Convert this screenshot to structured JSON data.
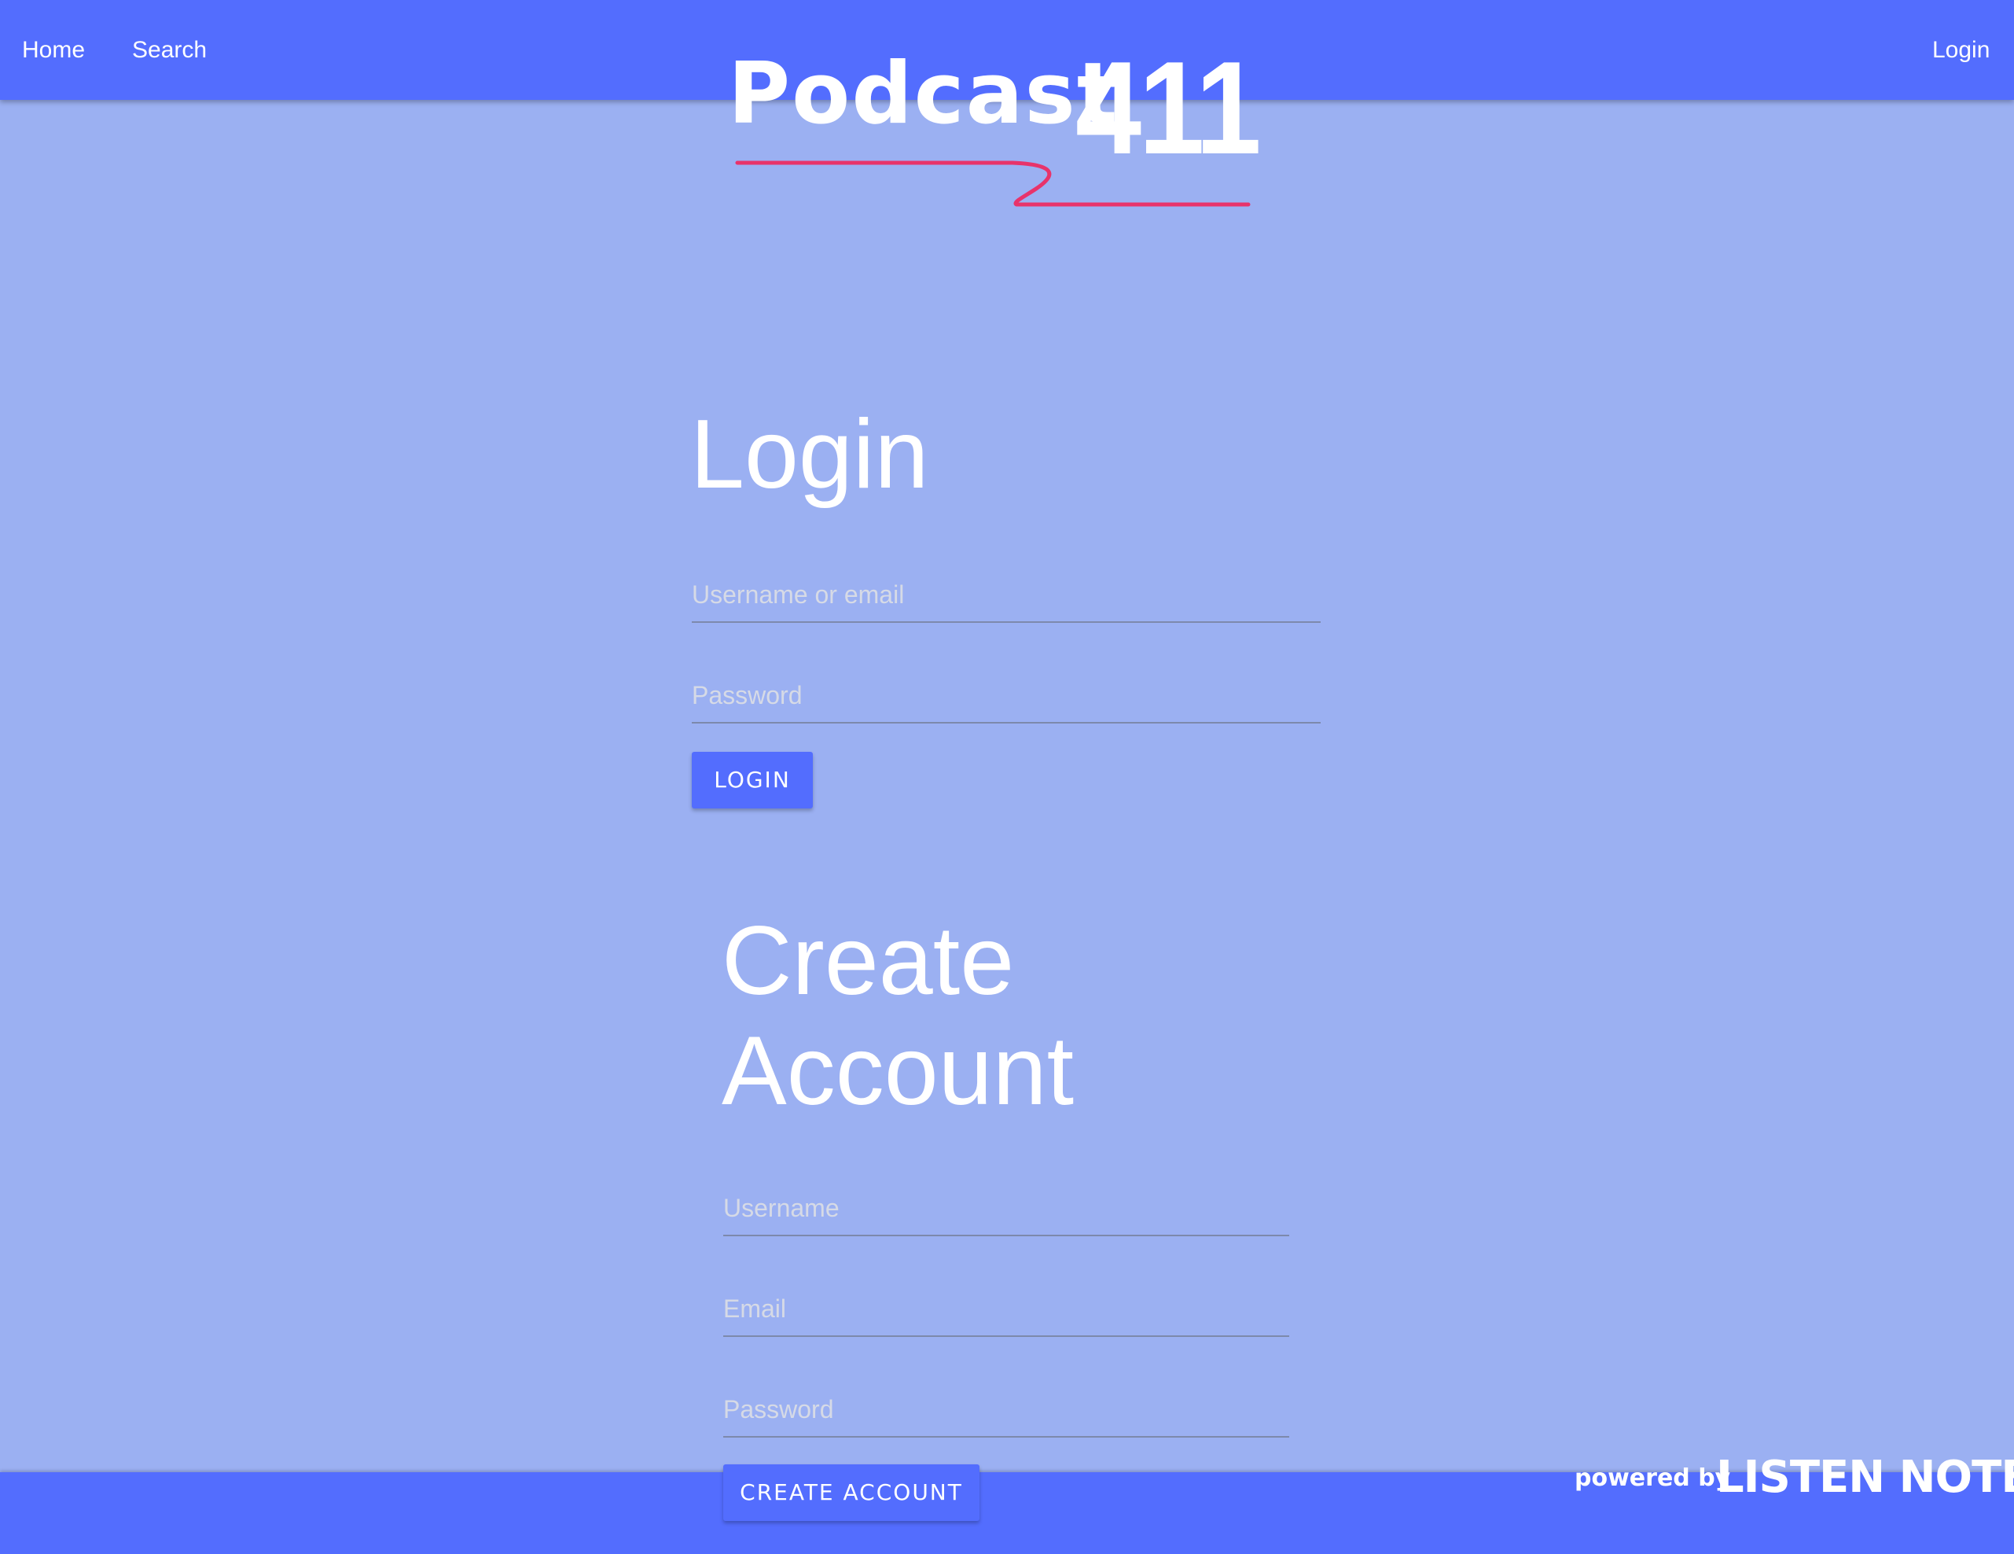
{
  "nav": {
    "home": "Home",
    "search": "Search",
    "login": "Login"
  },
  "logo": {
    "word": "Podcast",
    "number": "411"
  },
  "login_section": {
    "title": "Login",
    "username_placeholder": "Username or email",
    "password_placeholder": "Password",
    "button": "LOGIN"
  },
  "create_section": {
    "title_line1": "Create",
    "title_line2": "Account",
    "username_placeholder": "Username",
    "email_placeholder": "Email",
    "password_placeholder": "Password",
    "button": "CREATE ACCOUNT"
  },
  "footer": {
    "powered_by": "powered by",
    "brand": "LISTEN NOTES"
  },
  "colors": {
    "primary": "#536DFE",
    "background": "#9BB0F2",
    "accent_underline": "#E8336B"
  }
}
